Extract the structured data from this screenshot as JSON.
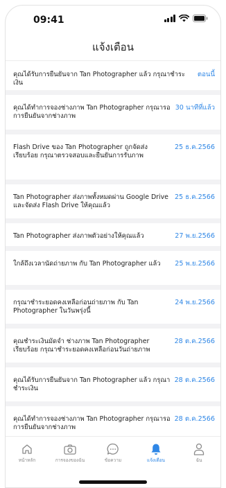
{
  "status_bar": {
    "time": "09:41"
  },
  "header": {
    "title": "แจ้งเตือน"
  },
  "notifications": [
    {
      "message": "คุณได้รับการยืนยันจาก Tan Photographer แล้ว กรุณาชำระเงิน",
      "time": "ตอนนี้"
    },
    {
      "message": "คุณได้ทำการจองช่างภาพ Tan Photographer กรุณารอการยืนยันจากช่างภาพ",
      "time": "30 นาทีที่แล้ว"
    },
    {
      "message": "Flash Drive ของ Tan Photographer ถูกจัดส่งเรียบร้อย กรุณาตรวจสอบและยืนยันการรับภาพ",
      "time": "25 ธ.ค.2566"
    },
    {
      "message": "Tan Photographer ส่งภาพทั้งหมดผ่าน Google Drive และจัดส่ง Flash Drive ให้คุณแล้ว",
      "time": "25 ธ.ค.2566"
    },
    {
      "message": "Tan Photographer ส่งภาพตัวอย่างให้คุณแล้ว",
      "time": "27 พ.ย.2566"
    },
    {
      "message": "ใกล้ถึงเวลานัดถ่ายภาพ กับ Tan Photographer  แล้ว",
      "time": "25 พ.ย.2566"
    },
    {
      "message": "กรุณาชำระยอดคงเหลือก่อนถ่ายภาพ กับ Tan Photographer ในวันพรุ่งนี้",
      "time": "24 พ.ย.2566"
    },
    {
      "message": "คุณชำระเงินมัดจำ ช่างภาพ Tan Photographer เรียบร้อย กรุณาชำระยอดคงเหลือก่อนวันถ่ายภาพ",
      "time": "28 ต.ค.2566"
    },
    {
      "message": "คุณได้รับการยืนยันจาก Tan Photographer แล้ว กรุณาชำระเงิน",
      "time": "28 ต.ค.2566"
    },
    {
      "message": "คุณได้ทำการจองช่างภาพ Tan Photographer กรุณารอการยืนยันจากช่างภาพ",
      "time": "28 ต.ค.2566"
    }
  ],
  "bottom_nav": {
    "items": [
      {
        "label": "หน้าหลัก",
        "icon": "home-icon"
      },
      {
        "label": "การจองของฉัน",
        "icon": "camera-icon"
      },
      {
        "label": "ข้อความ",
        "icon": "chat-icon"
      },
      {
        "label": "แจ้งเตือน",
        "icon": "bell-icon",
        "active": true
      },
      {
        "label": "ฉัน",
        "icon": "user-icon"
      }
    ]
  },
  "colors": {
    "accent": "#2f87e6",
    "inactive": "#8a8a8a",
    "separator": "#f2f2f4"
  }
}
